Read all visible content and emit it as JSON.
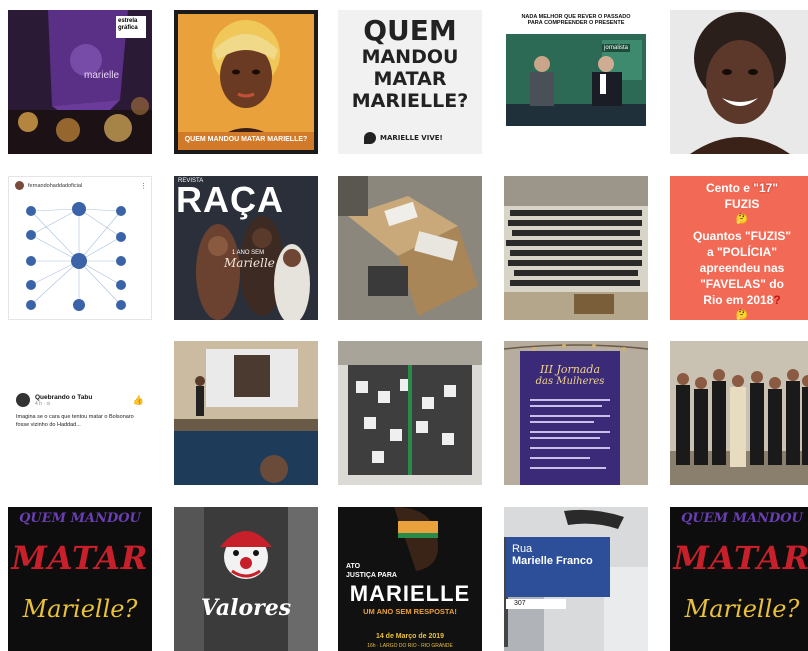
{
  "tiles": {
    "t1": {
      "badge": "estrela gráfica"
    },
    "t2": {
      "caption": "QUEM MANDOU MATAR MARIELLE?"
    },
    "t3": {
      "lines": [
        "QUEM",
        "MANDOU",
        "MATAR",
        "MARIELLE?"
      ],
      "footer": "MARIELLE VIVE!"
    },
    "t4": {
      "headline_1": "NADA MELHOR QUE REVER O PASSADO",
      "headline_2": "PARA COMPREENDER O PRESENTE",
      "channel": "jornalista"
    },
    "t6": {
      "account": "fernandohaddadoficial",
      "menu": "⋮"
    },
    "t7": {
      "magazine_small": "REVISTA",
      "magazine": "RAÇA",
      "cover_line_1": "1 ANO SEM",
      "cover_line_2": "Marielle"
    },
    "t10": {
      "line1a": "Cento e ",
      "line1b": "\"17\"",
      "line2": "FUZIS",
      "line3a": "Quantos ",
      "line3b": "\"FUZIS\"",
      "line4": "a \"POLÍCIA\"",
      "line5": "apreendeu nas",
      "line6a": "\"FAVELAS\"",
      "line6b": " do",
      "line7": "Rio em 2018",
      "emoji1": "🤔",
      "emoji2": "🤔"
    },
    "t11": {
      "page_name": "Quebrando o Tabu",
      "meta": "4 h · ⊙",
      "text": "Imagina se o cara que tentou matar o Bolsonaro fosse vizinho do Haddad..."
    },
    "t14": {
      "title_1": "III Jornada",
      "title_2": "das Mulheres"
    },
    "t16": {
      "line1": "QUEM MANDOU",
      "line2": "MATAR",
      "line3": "Marielle?"
    },
    "t17": {
      "word": "Valores"
    },
    "t18": {
      "pre": "ATO",
      "sub": "JUSTIÇA PARA",
      "name": "MARIELLE",
      "tag": "UM ANO SEM RESPOSTA!",
      "date": "14 de Março de 2019",
      "place": "16h · LARGO DO RIO - RIO GRANDE"
    },
    "t19": {
      "sign_line1": "Rua",
      "sign_line2": "Marielle Franco",
      "number": "307"
    },
    "t20": {
      "line1": "QUEM MANDOU",
      "line2": "MATAR",
      "line3": "Marielle?"
    }
  },
  "colors": {
    "fuzis_bg": "#f26a55",
    "raca_title": "#ffffff",
    "jornada_purple": "#3b2a78",
    "dark_red": "#c8202a",
    "dark_purple": "#6a3fb5",
    "dark_yellow": "#e9c13a",
    "sign_blue": "#2d4f9a"
  },
  "icons": [
    "like-icon",
    "menu-dots-icon",
    "avatar-icon"
  ]
}
